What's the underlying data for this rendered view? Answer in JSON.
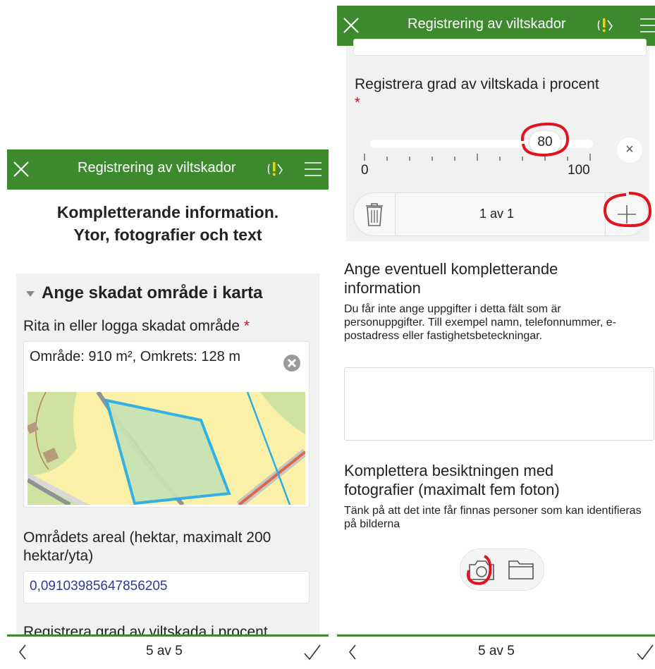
{
  "left": {
    "header": {
      "title": "Registrering av viltskador"
    },
    "page_title_line1": "Kompletterande information.",
    "page_title_line2": "Ytor, fotografier och text",
    "section": {
      "title": "Ange skadat område i karta",
      "field_label": "Rita in eller logga skadat område",
      "required_mark": "*",
      "geometry_text": "Område: 910 m², Omkrets: 128 m"
    },
    "areal": {
      "label": "Områdets areal (hektar, maximalt 200 hektar/yta)",
      "value": "0,09103985647856205"
    },
    "partial_label": "Registrera grad av viltskada i procent",
    "footer": {
      "pager": "5 av 5"
    }
  },
  "right": {
    "header": {
      "title": "Registrering av viltskador"
    },
    "slider": {
      "label": "Registrera grad av viltskada i procent",
      "required_mark": "*",
      "value": "80",
      "min_label": "0",
      "max_label": "100",
      "fraction": 0.8
    },
    "repeat": {
      "pager": "1 av 1"
    },
    "info": {
      "label": "Ange eventuell kompletterande information",
      "hint": "Du får inte ange uppgifter i detta fält som är personuppgifter. Till exempel namn, telefonnummer, e-postadress eller fastighetsbeteckningar.",
      "value": ""
    },
    "photos": {
      "label": "Komplettera besiktningen med fotografier (maximalt fem foton)",
      "hint": "Tänk på att det inte får finnas personer som kan identifieras på bilderna"
    },
    "footer": {
      "pager": "5 av 5"
    }
  },
  "colors": {
    "header": "#3d8a2e",
    "annotation": "#e0141e",
    "polygon": "#29aee8",
    "link_value": "#2c3b9a"
  }
}
